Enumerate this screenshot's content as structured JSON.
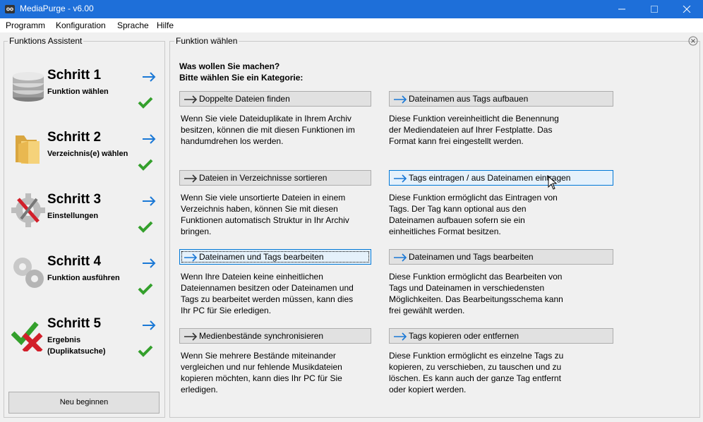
{
  "window": {
    "title": "MediaPurge - v6.00"
  },
  "menu": [
    "Programm",
    "Konfiguration",
    "Sprache",
    "Hilfe"
  ],
  "assistant": {
    "title": "Funktions Assistent",
    "steps": [
      {
        "title": "Schritt 1",
        "subtitle": "Funktion wählen",
        "icon": "database-icon"
      },
      {
        "title": "Schritt 2",
        "subtitle": "Verzeichnis(e) wählen",
        "icon": "folder-icon"
      },
      {
        "title": "Schritt 3",
        "subtitle": "Einstellungen",
        "icon": "settings-tools-icon"
      },
      {
        "title": "Schritt 4",
        "subtitle": "Funktion ausführen",
        "icon": "gears-icon"
      },
      {
        "title": "Schritt 5",
        "subtitle": "Ergebnis\n(Duplikatsuche)",
        "icon": "check-cross-icon"
      }
    ],
    "restart_label": "Neu beginnen"
  },
  "main": {
    "title": "Funktion wählen",
    "heading_line1": "Was wollen Sie machen?",
    "heading_line2": "Bitte wählen Sie ein Kategorie:",
    "functions": [
      {
        "label": "Doppelte Dateien finden",
        "desc": "Wenn Sie viele Dateiduplikate in Ihrem Archiv\nbesitzen, können die mit diesen Funktionen im\nhandumdrehen los werden."
      },
      {
        "label": "Dateinamen aus Tags  aufbauen",
        "desc": "Diese Funktion vereinheitlicht die Benennung\nder  Mediendateien auf Ihrer Festplatte. Das\nFormat kann frei eingestellt werden."
      },
      {
        "label": "Dateien in Verzeichnisse sortieren",
        "desc": "Wenn Sie viele unsortierte Dateien in einem\nVerzeichnis  haben, können Sie mit diesen\nFunktionen automatisch  Struktur in Ihr Archiv\nbringen."
      },
      {
        "label": "Tags eintragen / aus Dateinamen eintragen",
        "desc": "Diese Funktion ermöglicht das Eintragen von\nTags. Der Tag kann optional aus den\nDateinamen aufbauen sofern sie ein\neinheitliches Format besitzen."
      },
      {
        "label": "Dateinamen und Tags bearbeiten",
        "desc": "Wenn Ihre Dateien keine einheitlichen\nDateiennamen besitzen oder Dateinamen und\nTags zu bearbeitet werden müssen,  kann dies\nIhr PC für Sie erledigen."
      },
      {
        "label": "Dateinamen und Tags bearbeiten",
        "desc": "Diese Funktion ermöglicht das Bearbeiten von\nTags und Dateinamen in verschiedensten\nMöglichkeiten. Das Bearbeitungsschema kann\nfrei gewählt werden."
      },
      {
        "label": "Medienbestände synchronisieren",
        "desc": "Wenn Sie mehrere Bestände miteinander\nvergleichen und nur fehlende Musikdateien\nkopieren möchten, kann dies Ihr PC für Sie\nerledigen."
      },
      {
        "label": "Tags kopieren oder entfernen",
        "desc": "Diese Funktion ermöglicht es einzelne Tags zu\nkopieren,  zu verschieben, zu tauschen und zu\nlöschen. Es kann auch der ganze Tag entfernt\noder kopiert werden."
      }
    ]
  },
  "colors": {
    "titlebar": "#1e6fd9",
    "arrow": "#1a78d6",
    "check": "#34a02c"
  }
}
